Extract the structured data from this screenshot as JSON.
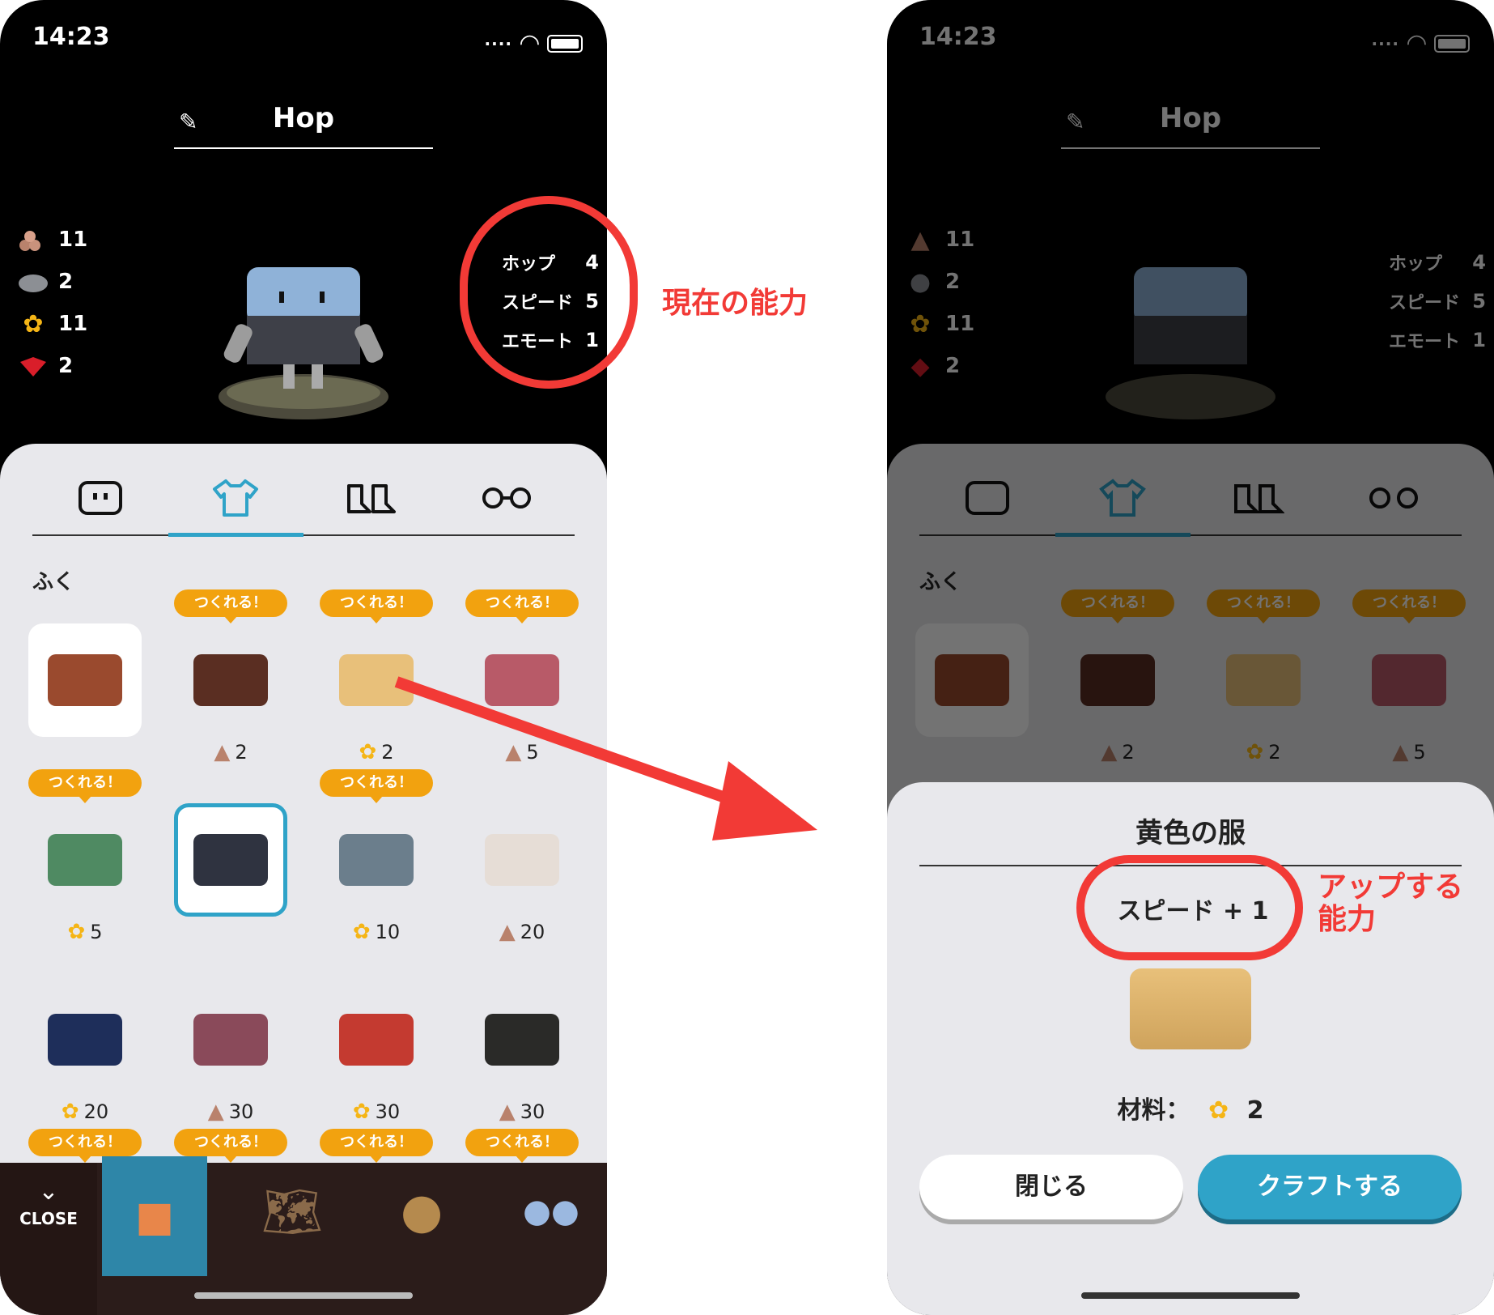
{
  "status": {
    "time": "14:23"
  },
  "character": {
    "name": "Hop"
  },
  "resources": [
    {
      "icon": "wood-icon",
      "count": "11"
    },
    {
      "icon": "stone-icon",
      "count": "2"
    },
    {
      "icon": "flower-icon",
      "count": "11"
    },
    {
      "icon": "gem-icon",
      "count": "2"
    }
  ],
  "stats": [
    {
      "label": "ホップ",
      "value": "4"
    },
    {
      "label": "スピード",
      "value": "5"
    },
    {
      "label": "エモート",
      "value": "1"
    }
  ],
  "tabs": [
    "face",
    "shirt",
    "shoes",
    "glasses"
  ],
  "section_title": "ふく",
  "badge_label": "つくれる！",
  "clothes": [
    {
      "color": "#9a4a2e",
      "cost": "",
      "icon": "",
      "badge": false,
      "card": "white"
    },
    {
      "color": "#5a2e22",
      "cost": "2",
      "icon": "wood-icon",
      "badge": true
    },
    {
      "color": "#e8c07a",
      "cost": "2",
      "icon": "flower-icon",
      "badge": true
    },
    {
      "color": "#b85a68",
      "cost": "5",
      "icon": "wood-icon",
      "badge": true
    },
    {
      "color": "#4f8a62",
      "cost": "5",
      "icon": "flower-icon",
      "badge": true
    },
    {
      "color": "#2f3340",
      "cost": "",
      "icon": "",
      "badge": false,
      "card": "selected"
    },
    {
      "color": "#6b7e8c",
      "cost": "10",
      "icon": "flower-icon",
      "badge": true
    },
    {
      "color": "#e6ddd6",
      "cost": "20",
      "icon": "wood-icon",
      "badge": false
    },
    {
      "color": "#1e2e5a",
      "cost": "20",
      "icon": "flower-icon",
      "badge": false
    },
    {
      "color": "#8a4a5a",
      "cost": "30",
      "icon": "wood-icon",
      "badge": false
    },
    {
      "color": "#c43a30",
      "cost": "30",
      "icon": "flower-icon",
      "badge": false
    },
    {
      "color": "#2a2a28",
      "cost": "30",
      "icon": "wood-icon",
      "badge": false
    }
  ],
  "bottom_nav": {
    "close_label": "CLOSE"
  },
  "annotations": {
    "current_ability": "現在の能力",
    "up_ability": "アップする\n能力"
  },
  "sheet": {
    "title": "黄色の服",
    "ability": "スピード + 1",
    "material_label": "材料：",
    "material_count": "2",
    "close_button": "閉じる",
    "craft_button": "クラフトする"
  },
  "colors": {
    "accent": "#2fa3c8",
    "badge": "#f2a20f",
    "annotation": "#f23a36"
  }
}
